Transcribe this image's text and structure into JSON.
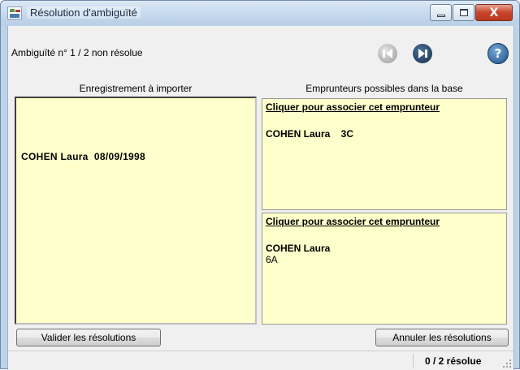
{
  "window": {
    "title": "Résolution d'ambiguïté",
    "controls": {
      "minimize": "—",
      "maximize": "□",
      "close": "X"
    }
  },
  "header": {
    "status": "Ambiguïté n° 1 / 2 non résolue",
    "nav": {
      "prev_icon": "skip-previous-icon",
      "next_icon": "skip-next-icon",
      "help_icon": "help-icon",
      "help_glyph": "?"
    }
  },
  "columns": {
    "left_header": "Enregistrement à importer",
    "right_header": "Emprunteurs possibles dans la base"
  },
  "record": {
    "text": "COHEN Laura  08/09/1998"
  },
  "candidates": [
    {
      "link": "Cliquer pour associer cet emprunteur",
      "name": "COHEN Laura    3C",
      "class": ""
    },
    {
      "link": "Cliquer pour associer cet emprunteur",
      "name": "COHEN Laura",
      "class": "6A"
    }
  ],
  "buttons": {
    "validate": "Valider les résolutions",
    "cancel": "Annuler les résolutions"
  },
  "statusbar": {
    "text": "0 / 2 résolue"
  },
  "colors": {
    "panel_bg": "#ffffcc",
    "frame": "#bcd3ea",
    "close_button": "#c8442a"
  }
}
